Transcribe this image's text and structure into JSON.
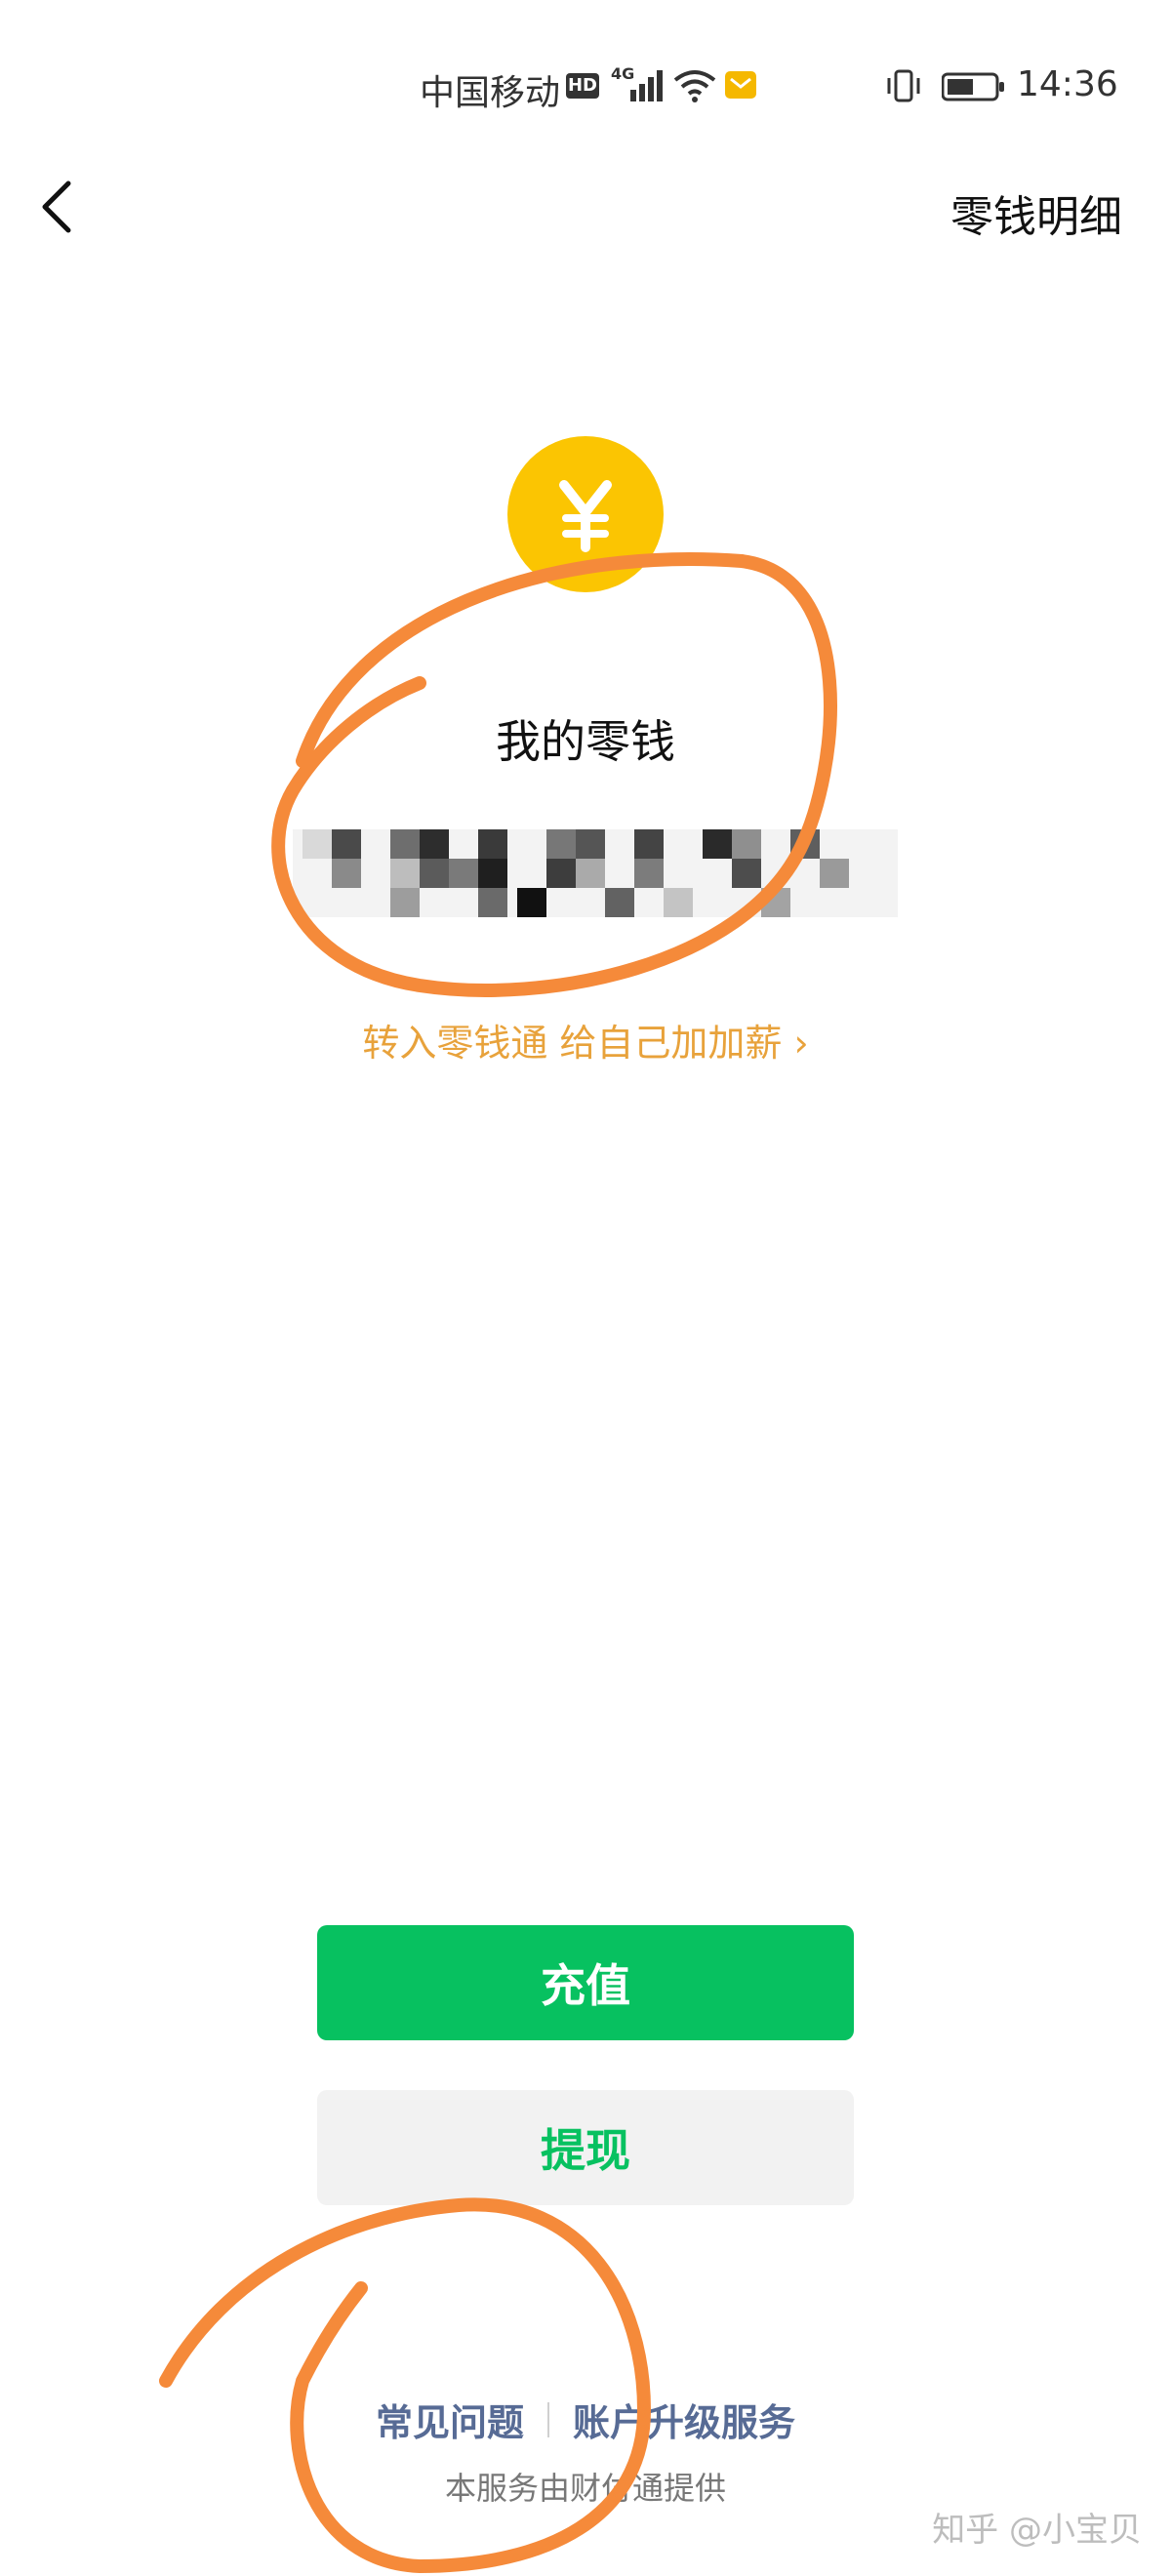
{
  "status_bar": {
    "carrier": "中国移动",
    "hd_badge": "HD",
    "network": "4G",
    "time": "14:36"
  },
  "nav": {
    "back_icon": "chevron-left-icon",
    "title": "零钱明细"
  },
  "wallet": {
    "coin_symbol": "¥",
    "balance_label": "我的零钱",
    "promo_text": "转入零钱通 给自己加加薪 ›"
  },
  "actions": {
    "recharge_label": "充值",
    "withdraw_label": "提现"
  },
  "footer": {
    "faq_label": "常见问题",
    "upgrade_label": "账户升级服务",
    "provider_note": "本服务由财付通提供"
  },
  "watermark": "知乎 @小宝贝",
  "colors": {
    "primary_green": "#07c160",
    "coin_yellow": "#fbc502",
    "promo_orange": "#e8a23b",
    "link_blue": "#576b95",
    "annotation_orange": "#f58a3a"
  }
}
